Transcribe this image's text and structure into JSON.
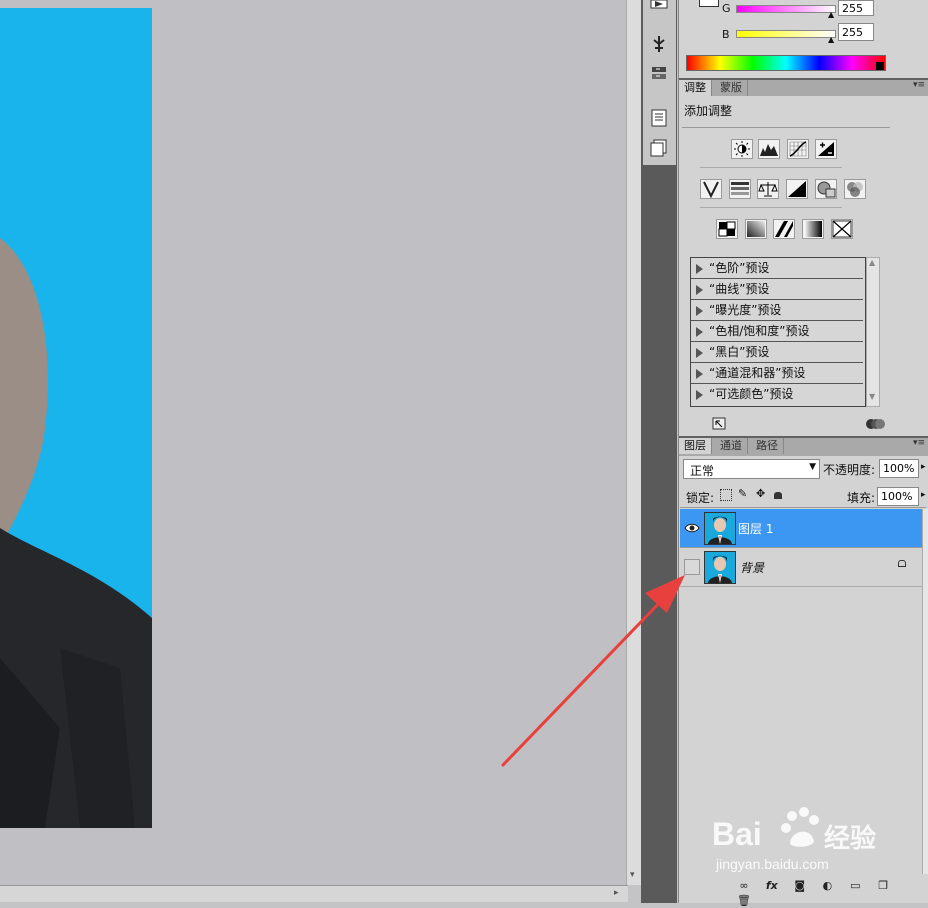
{
  "color_panel": {
    "g_label": "G",
    "g_value": "255",
    "b_label": "B",
    "b_value": "255"
  },
  "adjust_panel": {
    "tabs": [
      "调整",
      "蒙版"
    ],
    "title": "添加调整",
    "presets": [
      "“色阶”预设",
      "“曲线”预设",
      "“曝光度”预设",
      "“色相/饱和度”预设",
      "“黑白”预设",
      "“通道混和器”预设",
      "“可选颜色”预设"
    ]
  },
  "layers_panel": {
    "tabs": [
      "图层",
      "通道",
      "路径"
    ],
    "blend_mode": "正常",
    "opacity_label": "不透明度:",
    "opacity_value": "100%",
    "lock_label": "锁定:",
    "fill_label": "填充:",
    "fill_value": "100%",
    "layers": [
      {
        "name": "图层 1",
        "selected": true,
        "visible": true
      },
      {
        "name": "背景",
        "selected": false,
        "visible": false
      }
    ]
  },
  "watermark": {
    "brand": "Bai",
    "brand2": "经验",
    "url": "jingyan.baidu.com"
  },
  "colors": {
    "canvas_bg": "#c0bfc3",
    "photo_bg": "#19b4ec",
    "selection_blue": "#3c97f2",
    "arrow_red": "#e8403c"
  }
}
